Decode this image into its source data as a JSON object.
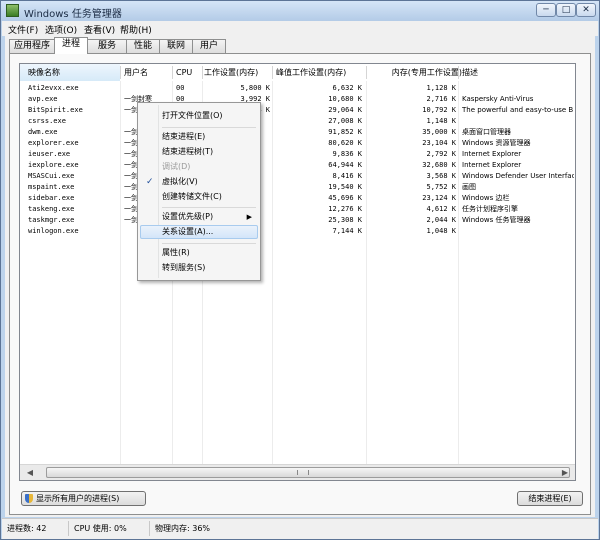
{
  "window": {
    "title": "Windows 任务管理器",
    "controls": {
      "minimize": "─",
      "maximize": "□",
      "close": "✕"
    }
  },
  "menubar": [
    "文件(F)",
    "选项(O)",
    "查看(V)",
    "帮助(H)"
  ],
  "tabs": [
    "应用程序",
    "进程",
    "服务",
    "性能",
    "联网",
    "用户"
  ],
  "active_tab": "进程",
  "columns": [
    "映像名称",
    "用户名",
    "CPU",
    "工作设置(内存)",
    "峰值工作设置(内存)",
    "内存(专用工作设置)",
    "描述"
  ],
  "processes": [
    {
      "name": "Ati2evxx.exe",
      "user": "",
      "cpu": "00",
      "ws": "5,800 K",
      "peak": "6,632 K",
      "priv": "1,128 K",
      "desc": ""
    },
    {
      "name": "avp.exe",
      "user": "一剑封寒",
      "cpu": "00",
      "ws": "3,992 K",
      "peak": "10,680 K",
      "priv": "2,716 K",
      "desc": "Kaspersky Anti-Virus"
    },
    {
      "name": "BitSpirit.exe",
      "user": "一剑封寒",
      "cpu": "00",
      "ws": "21,304 K",
      "peak": "29,064 K",
      "priv": "10,792 K",
      "desc": "The powerful and easy-to-use B"
    },
    {
      "name": "csrss.exe",
      "user": "",
      "cpu": "",
      "ws": "",
      "peak": "27,008 K",
      "priv": "1,148 K",
      "desc": ""
    },
    {
      "name": "dwm.exe",
      "user": "一剑",
      "cpu": "",
      "ws": "",
      "peak": "91,852 K",
      "priv": "35,000 K",
      "desc": "桌面窗口管理器"
    },
    {
      "name": "explorer.exe",
      "user": "一剑",
      "cpu": "",
      "ws": "",
      "peak": "80,620 K",
      "priv": "23,104 K",
      "desc": "Windows 资源管理器"
    },
    {
      "name": "ieuser.exe",
      "user": "一剑",
      "cpu": "",
      "ws": "",
      "peak": "9,836 K",
      "priv": "2,792 K",
      "desc": "Internet Explorer"
    },
    {
      "name": "iexplore.exe",
      "user": "一剑",
      "cpu": "",
      "ws": "",
      "peak": "64,944 K",
      "priv": "32,680 K",
      "desc": "Internet Explorer"
    },
    {
      "name": "MSASCui.exe",
      "user": "一剑",
      "cpu": "",
      "ws": "",
      "peak": "8,416 K",
      "priv": "3,568 K",
      "desc": "Windows Defender User Interfac"
    },
    {
      "name": "mspaint.exe",
      "user": "一剑",
      "cpu": "",
      "ws": "",
      "peak": "19,540 K",
      "priv": "5,752 K",
      "desc": "画图"
    },
    {
      "name": "sidebar.exe",
      "user": "一剑",
      "cpu": "",
      "ws": "",
      "peak": "45,696 K",
      "priv": "23,124 K",
      "desc": "Windows 边栏"
    },
    {
      "name": "taskeng.exe",
      "user": "一剑",
      "cpu": "",
      "ws": "",
      "peak": "12,276 K",
      "priv": "4,612 K",
      "desc": "任务计划程序引擎"
    },
    {
      "name": "taskmgr.exe",
      "user": "一剑",
      "cpu": "",
      "ws": "",
      "peak": "25,308 K",
      "priv": "2,044 K",
      "desc": "Windows 任务管理器"
    },
    {
      "name": "winlogon.exe",
      "user": "",
      "cpu": "",
      "ws": "",
      "peak": "7,144 K",
      "priv": "1,048 K",
      "desc": ""
    }
  ],
  "context_menu": {
    "open_location": "打开文件位置(O)",
    "end_process": "结束进程(E)",
    "end_tree": "结束进程树(T)",
    "debug": "调试(D)",
    "virtualization": "虚拟化(V)",
    "dump": "创建转储文件(C)",
    "priority": "设置优先级(P)",
    "affinity": "关系设置(A)...",
    "properties": "属性(R)",
    "goto_service": "转到服务(S)",
    "check_mark": "✓",
    "submenu_arrow": "▶"
  },
  "scrollbar": {
    "left_arrow": "◀",
    "right_arrow": "▶"
  },
  "buttons": {
    "show_all": "显示所有用户的进程(S)",
    "end_process": "结束进程(E)"
  },
  "statusbar": {
    "processes": "进程数: 42",
    "cpu": "CPU 使用: 0%",
    "memory": "物理内存: 36%"
  }
}
